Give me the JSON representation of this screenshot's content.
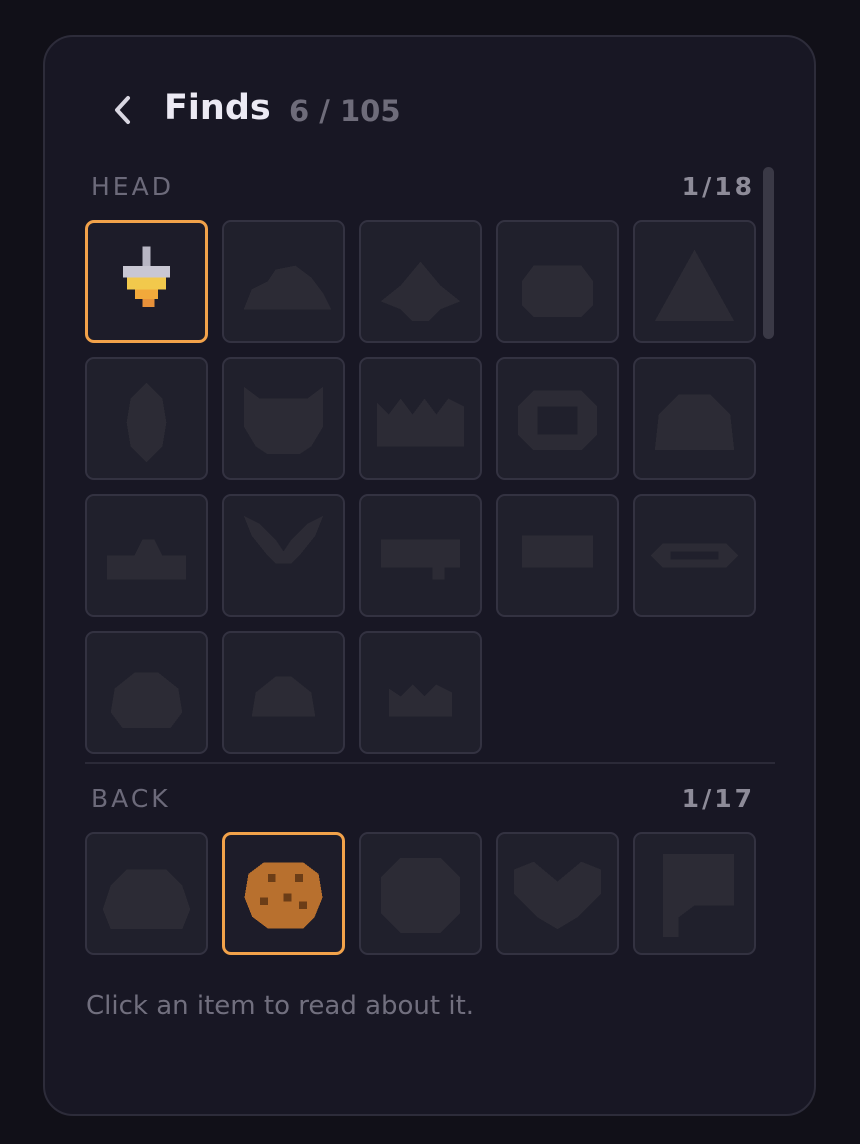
{
  "header": {
    "back_icon": "chevron-left-icon",
    "title": "Finds",
    "count": "6 / 105"
  },
  "sections": [
    {
      "label": "HEAD",
      "count": "1/18",
      "items": [
        {
          "icon": "lamp-hat-icon",
          "found": true
        },
        {
          "icon": "cloud-hat-icon",
          "found": false
        },
        {
          "icon": "spiked-hat-icon",
          "found": false
        },
        {
          "icon": "round-cap-icon",
          "found": false
        },
        {
          "icon": "cone-hat-icon",
          "found": false
        },
        {
          "icon": "egg-helmet-icon",
          "found": false
        },
        {
          "icon": "horned-helmet-icon",
          "found": false
        },
        {
          "icon": "crown-icon",
          "found": false
        },
        {
          "icon": "halo-ring-icon",
          "found": false
        },
        {
          "icon": "dome-helmet-icon",
          "found": false
        },
        {
          "icon": "flat-cap-icon",
          "found": false
        },
        {
          "icon": "antlers-icon",
          "found": false
        },
        {
          "icon": "headband-icon",
          "found": false
        },
        {
          "icon": "visor-icon",
          "found": false
        },
        {
          "icon": "ring-halo-icon",
          "found": false
        },
        {
          "icon": "hood-icon",
          "found": false
        },
        {
          "icon": "beanie-icon",
          "found": false
        },
        {
          "icon": "small-crown-icon",
          "found": false
        }
      ]
    },
    {
      "label": "BACK",
      "count": "1/17",
      "items": [
        {
          "icon": "bag-icon",
          "found": false
        },
        {
          "icon": "cookie-shell-icon",
          "found": true,
          "color": "#b8702e"
        },
        {
          "icon": "round-shield-icon",
          "found": false
        },
        {
          "icon": "wings-icon",
          "found": false
        },
        {
          "icon": "flag-icon",
          "found": false
        }
      ]
    }
  ],
  "hint": "Click an item to read about it.",
  "colors": {
    "background": "#111018",
    "panel": "#181724",
    "accent_found": "#f2a24a",
    "locked_silhouette": "#2c2b35"
  }
}
